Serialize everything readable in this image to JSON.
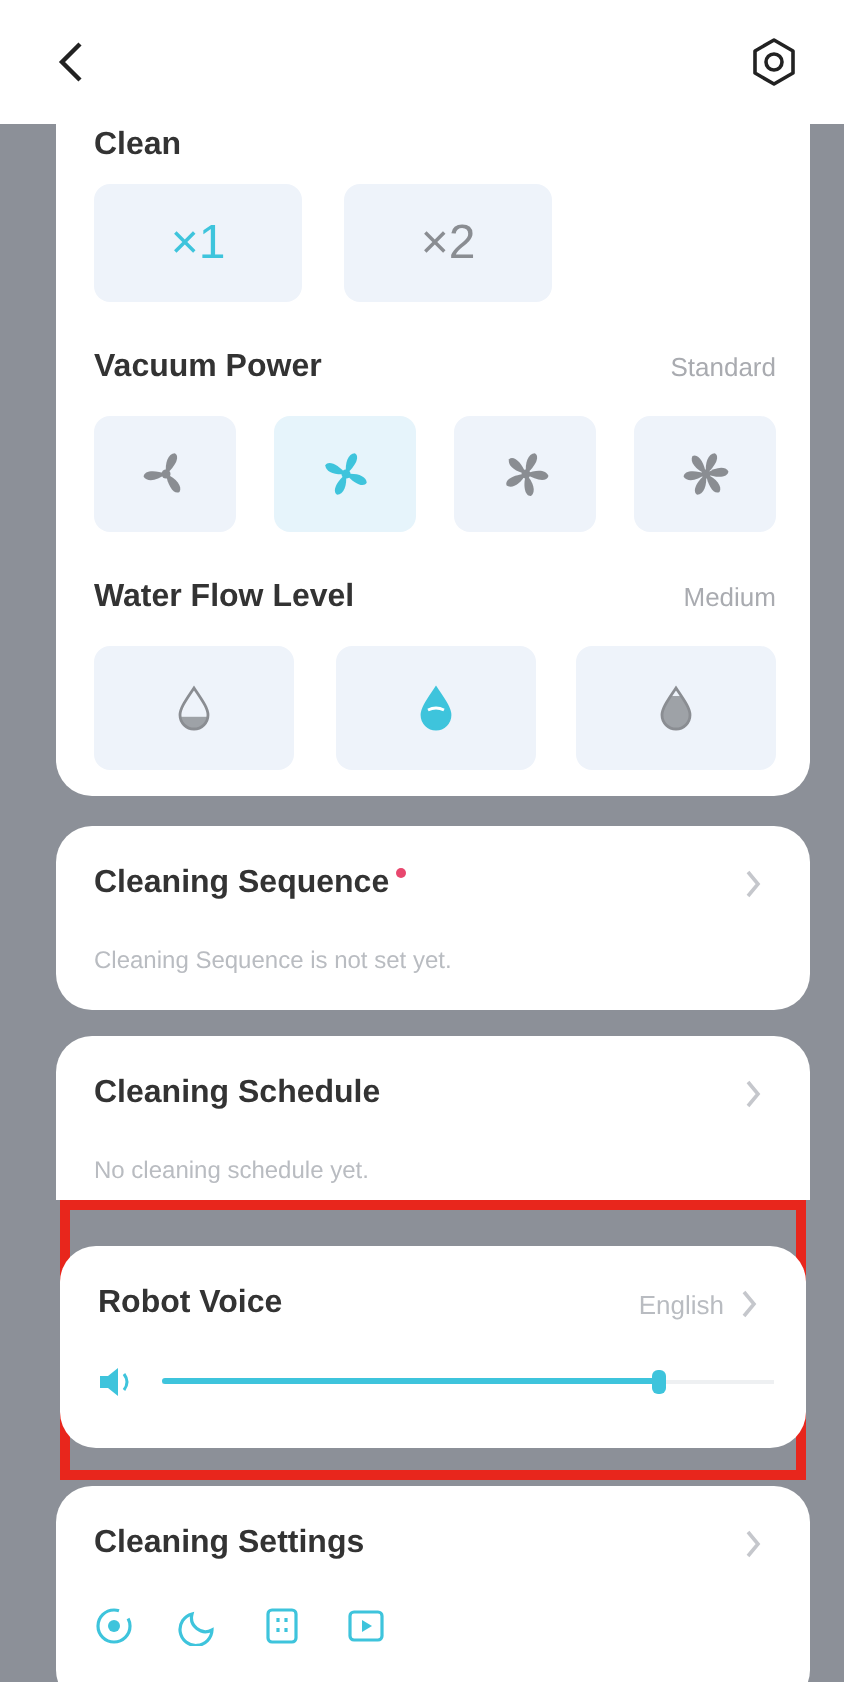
{
  "clean": {
    "label": "Clean",
    "options": [
      {
        "label": "×1",
        "selected": true
      },
      {
        "label": "×2",
        "selected": false
      }
    ]
  },
  "vacuum_power": {
    "label": "Vacuum Power",
    "value": "Standard",
    "levels": [
      {
        "kind": "quiet",
        "selected": false
      },
      {
        "kind": "standard",
        "selected": true
      },
      {
        "kind": "strong",
        "selected": false
      },
      {
        "kind": "max",
        "selected": false
      }
    ]
  },
  "water_flow": {
    "label": "Water Flow Level",
    "value": "Medium",
    "levels": [
      {
        "kind": "low",
        "selected": false
      },
      {
        "kind": "medium",
        "selected": true
      },
      {
        "kind": "high",
        "selected": false
      }
    ]
  },
  "cards": [
    {
      "kind": "info",
      "title": "Cleaning Sequence",
      "new_badge": true,
      "subtitle": "Cleaning Sequence is not set yet.",
      "highlighted": false
    },
    {
      "kind": "info",
      "title": "Cleaning Schedule",
      "new_badge": false,
      "subtitle": "No cleaning schedule yet.",
      "highlighted": false
    },
    {
      "kind": "voice",
      "title": "Robot Voice",
      "value": "English",
      "level": 0.81,
      "highlighted": true
    },
    {
      "kind": "settings",
      "title": "Cleaning Settings",
      "highlighted": false
    }
  ]
}
